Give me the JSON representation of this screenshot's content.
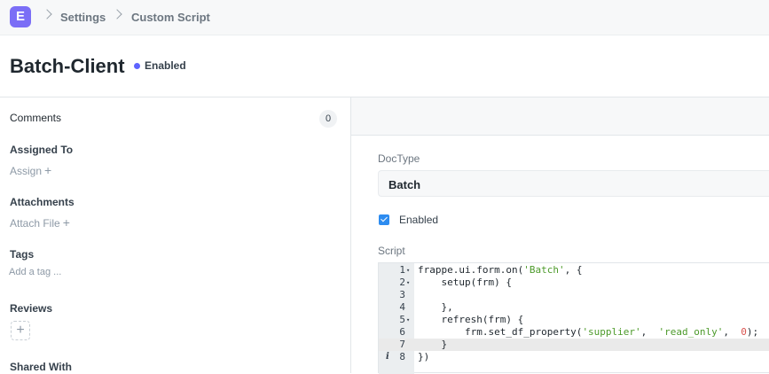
{
  "topbar": {
    "logo": "E",
    "breadcrumbs": [
      "Settings",
      "Custom Script"
    ]
  },
  "page": {
    "title": "Batch-Client",
    "status": "Enabled",
    "status_color": "#5e64ff"
  },
  "sidebar": {
    "comments_label": "Comments",
    "comments_count": "0",
    "assigned_to": "Assigned To",
    "assign": "Assign",
    "attachments": "Attachments",
    "attach_file": "Attach File",
    "tags": "Tags",
    "add_tag": "Add a tag ...",
    "reviews": "Reviews",
    "shared_with": "Shared With"
  },
  "form": {
    "doctype_label": "DocType",
    "doctype_value": "Batch",
    "enabled_label": "Enabled",
    "enabled_checked": true,
    "script_label": "Script"
  },
  "code": {
    "lines": [
      {
        "num": "1",
        "fold": true,
        "parts": [
          [
            "",
            "frappe.ui.form.on("
          ],
          [
            "str",
            "'Batch'"
          ],
          [
            "",
            ", {"
          ]
        ]
      },
      {
        "num": "2",
        "fold": true,
        "parts": [
          [
            "",
            "    setup(frm) {"
          ]
        ]
      },
      {
        "num": "3",
        "fold": false,
        "parts": [
          [
            "",
            "        "
          ]
        ]
      },
      {
        "num": "4",
        "fold": false,
        "parts": [
          [
            "",
            "    },"
          ]
        ]
      },
      {
        "num": "5",
        "fold": true,
        "parts": [
          [
            "",
            "    refresh(frm) {"
          ]
        ]
      },
      {
        "num": "6",
        "fold": false,
        "parts": [
          [
            "",
            "        frm.set_df_property("
          ],
          [
            "str",
            "'supplier'"
          ],
          [
            "",
            ",  "
          ],
          [
            "str",
            "'read_only'"
          ],
          [
            "",
            ",  "
          ],
          [
            "num",
            "0"
          ],
          [
            "",
            ");"
          ]
        ]
      },
      {
        "num": "7",
        "fold": false,
        "active": true,
        "parts": [
          [
            "",
            "    }"
          ]
        ]
      },
      {
        "num": "8",
        "fold": false,
        "info": true,
        "parts": [
          [
            "",
            "})"
          ]
        ]
      }
    ]
  }
}
